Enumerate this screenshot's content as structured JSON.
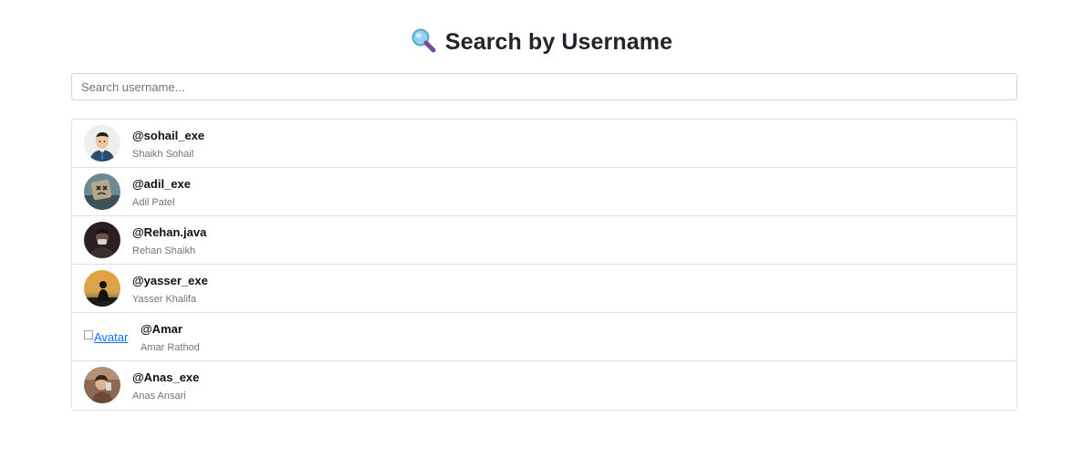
{
  "header": {
    "icon": "magnifier-icon",
    "title": "Search by Username"
  },
  "search": {
    "placeholder": "Search username...",
    "value": ""
  },
  "users": [
    {
      "username": "@sohail_exe",
      "name": "Shaikh Sohail",
      "avatar": "cartoon-man-avatar"
    },
    {
      "username": "@adil_exe",
      "name": "Adil Patel",
      "avatar": "masked-face-avatar"
    },
    {
      "username": "@Rehan.java",
      "name": "Rehan Shaikh",
      "avatar": "dark-portrait-avatar"
    },
    {
      "username": "@yasser_exe",
      "name": "Yasser Khalifa",
      "avatar": "sunset-silhouette-avatar"
    },
    {
      "username": "@Amar",
      "name": "Amar Rathod",
      "avatar": "broken-image",
      "avatar_alt": "Avatar"
    },
    {
      "username": "@Anas_exe",
      "name": "Anas Ansari",
      "avatar": "photo-portrait-avatar"
    }
  ],
  "colors": {
    "text": "#212529",
    "muted": "#6c757d",
    "border": "#dee2e6",
    "link": "#0d6efd"
  }
}
